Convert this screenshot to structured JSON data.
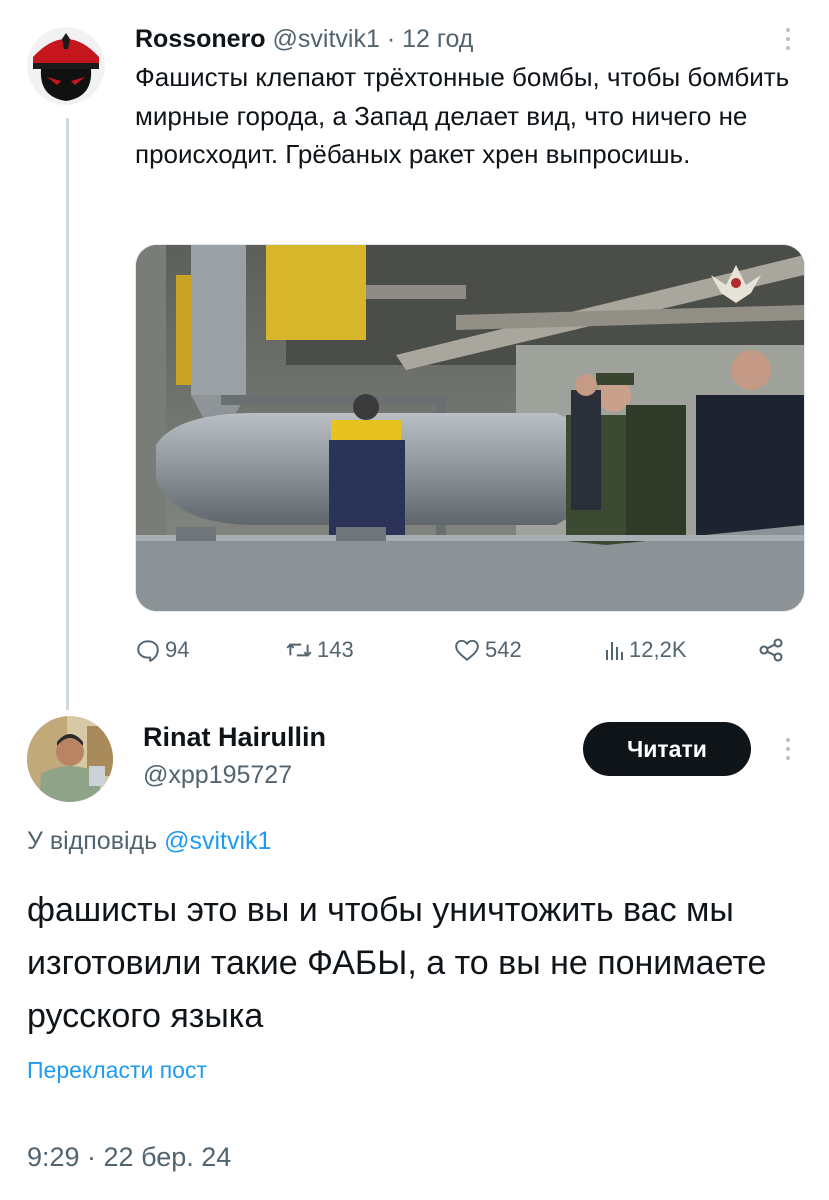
{
  "tweet1": {
    "author_name": "Rossonero",
    "author_handle": "@svitvik1",
    "separator": "·",
    "time": "12 год",
    "text": "Фашисты клепают трёхтонные бомбы, чтобы бомбить мирные города, а Запад делает вид, что ничего не происходит. Грёбаных ракет хрен выпросишь.",
    "metrics": {
      "replies": "94",
      "reposts": "143",
      "likes": "542",
      "views": "12,2K"
    }
  },
  "reply": {
    "author_name": "Rinat Hairullin",
    "author_handle": "@xpp195727",
    "read_button": "Читати",
    "reply_to_prefix": "У відповідь",
    "reply_to_handle": "@svitvik1",
    "text": "фашисты это вы и чтобы уничтожить вас мы изготовили такие ФАБЫ, а то вы не понимаете русского языка",
    "translate_link": "Перекласти пост",
    "timestamp": "9:29 · 22 бер. 24"
  },
  "colors": {
    "text": "#0f1419",
    "muted": "#536471",
    "accent": "#1d9bf0",
    "button": "#0f1419"
  },
  "icons": [
    "reply-icon",
    "repost-icon",
    "like-icon",
    "views-icon",
    "share-icon",
    "more-icon"
  ]
}
